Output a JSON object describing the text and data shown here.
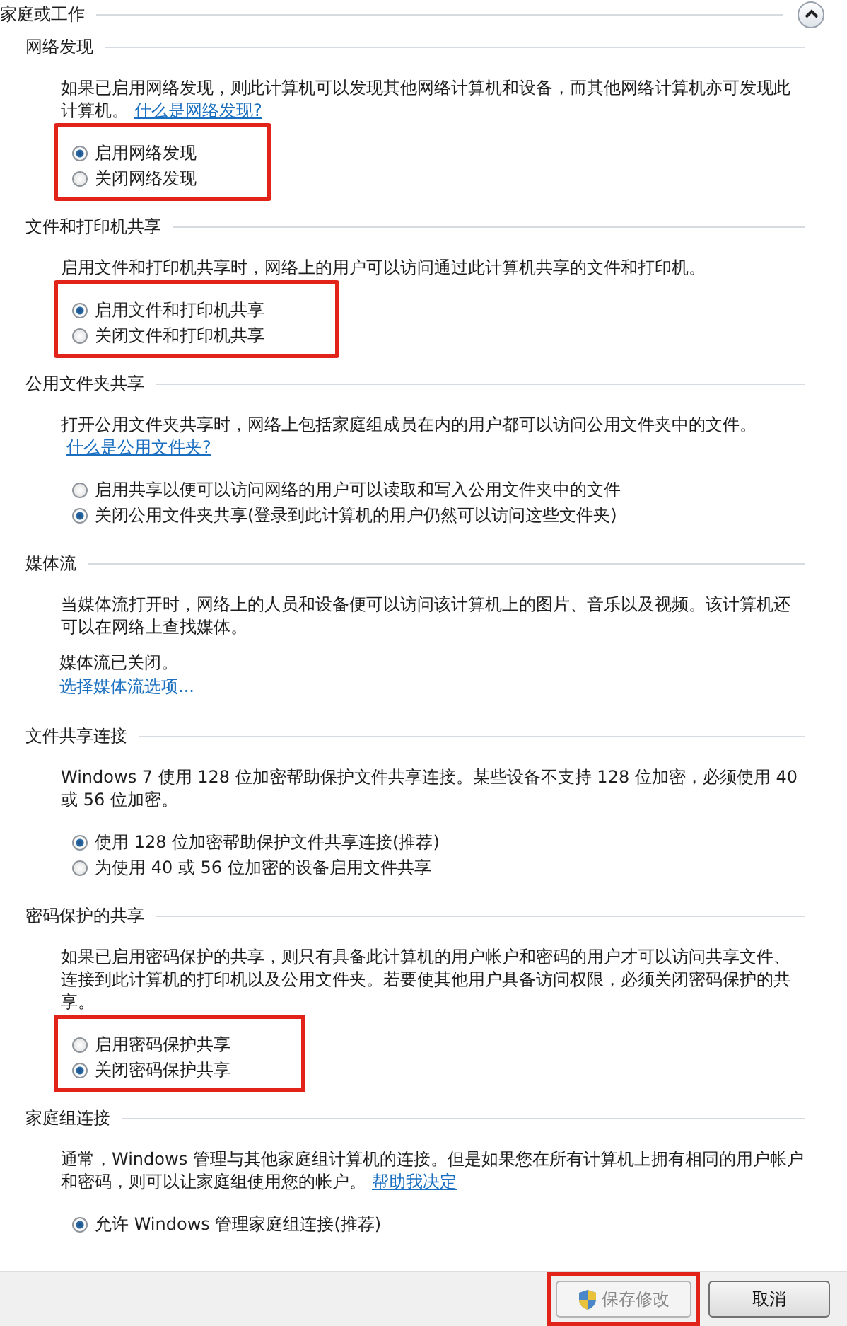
{
  "group_header": {
    "title": "家庭或工作",
    "expanded": true
  },
  "sections": [
    {
      "title": "网络发现",
      "description": {
        "text": "如果已启用网络发现，则此计算机可以发现其他网络计算机和设备，而其他网络计算机亦可发现此计算机。",
        "link": "什么是网络发现?"
      },
      "options": {
        "highlighted": true,
        "items": [
          {
            "label": "启用网络发现",
            "selected": true
          },
          {
            "label": "关闭网络发现",
            "selected": false
          }
        ]
      }
    },
    {
      "title": "文件和打印机共享",
      "description": {
        "text": "启用文件和打印机共享时，网络上的用户可以访问通过此计算机共享的文件和打印机。"
      },
      "options": {
        "highlighted": true,
        "items": [
          {
            "label": "启用文件和打印机共享",
            "selected": true
          },
          {
            "label": "关闭文件和打印机共享",
            "selected": false
          }
        ]
      }
    },
    {
      "title": "公用文件夹共享",
      "description": {
        "text": "打开公用文件夹共享时，网络上包括家庭组成员在内的用户都可以访问公用文件夹中的文件。",
        "link": "什么是公用文件夹?"
      },
      "options": {
        "highlighted": false,
        "items": [
          {
            "label": "启用共享以便可以访问网络的用户可以读取和写入公用文件夹中的文件",
            "selected": false
          },
          {
            "label": "关闭公用文件夹共享(登录到此计算机的用户仍然可以访问这些文件夹)",
            "selected": true
          }
        ]
      }
    },
    {
      "title": "媒体流",
      "description": {
        "text": "当媒体流打开时，网络上的人员和设备便可以访问该计算机上的图片、音乐以及视频。该计算机还可以在网络上查找媒体。"
      },
      "status": "媒体流已关闭。",
      "status_link": "选择媒体流选项..."
    },
    {
      "title": "文件共享连接",
      "description": {
        "text": "Windows 7 使用 128 位加密帮助保护文件共享连接。某些设备不支持 128 位加密，必须使用 40 或 56 位加密。"
      },
      "options": {
        "highlighted": false,
        "items": [
          {
            "label": "使用 128 位加密帮助保护文件共享连接(推荐)",
            "selected": true
          },
          {
            "label": "为使用 40 或 56 位加密的设备启用文件共享",
            "selected": false
          }
        ]
      }
    },
    {
      "title": "密码保护的共享",
      "description": {
        "text": "如果已启用密码保护的共享，则只有具备此计算机的用户帐户和密码的用户才可以访问共享文件、连接到此计算机的打印机以及公用文件夹。若要使其他用户具备访问权限，必须关闭密码保护的共享。"
      },
      "options": {
        "highlighted": true,
        "items": [
          {
            "label": "启用密码保护共享",
            "selected": false
          },
          {
            "label": "关闭密码保护共享",
            "selected": true
          }
        ]
      }
    },
    {
      "title": "家庭组连接",
      "description": {
        "text": "通常，Windows 管理与其他家庭组计算机的连接。但是如果您在所有计算机上拥有相同的用户帐户和密码，则可以让家庭组使用您的帐户。",
        "link": "帮助我决定"
      },
      "options": {
        "highlighted": false,
        "items": [
          {
            "label": "允许 Windows 管理家庭组连接(推荐)",
            "selected": true
          }
        ]
      }
    }
  ],
  "footer": {
    "buttons": [
      {
        "label": "保存修改",
        "kind": "shield",
        "disabled": true,
        "highlighted": true
      },
      {
        "label": "取消",
        "kind": "plain",
        "disabled": false,
        "highlighted": false
      }
    ]
  }
}
